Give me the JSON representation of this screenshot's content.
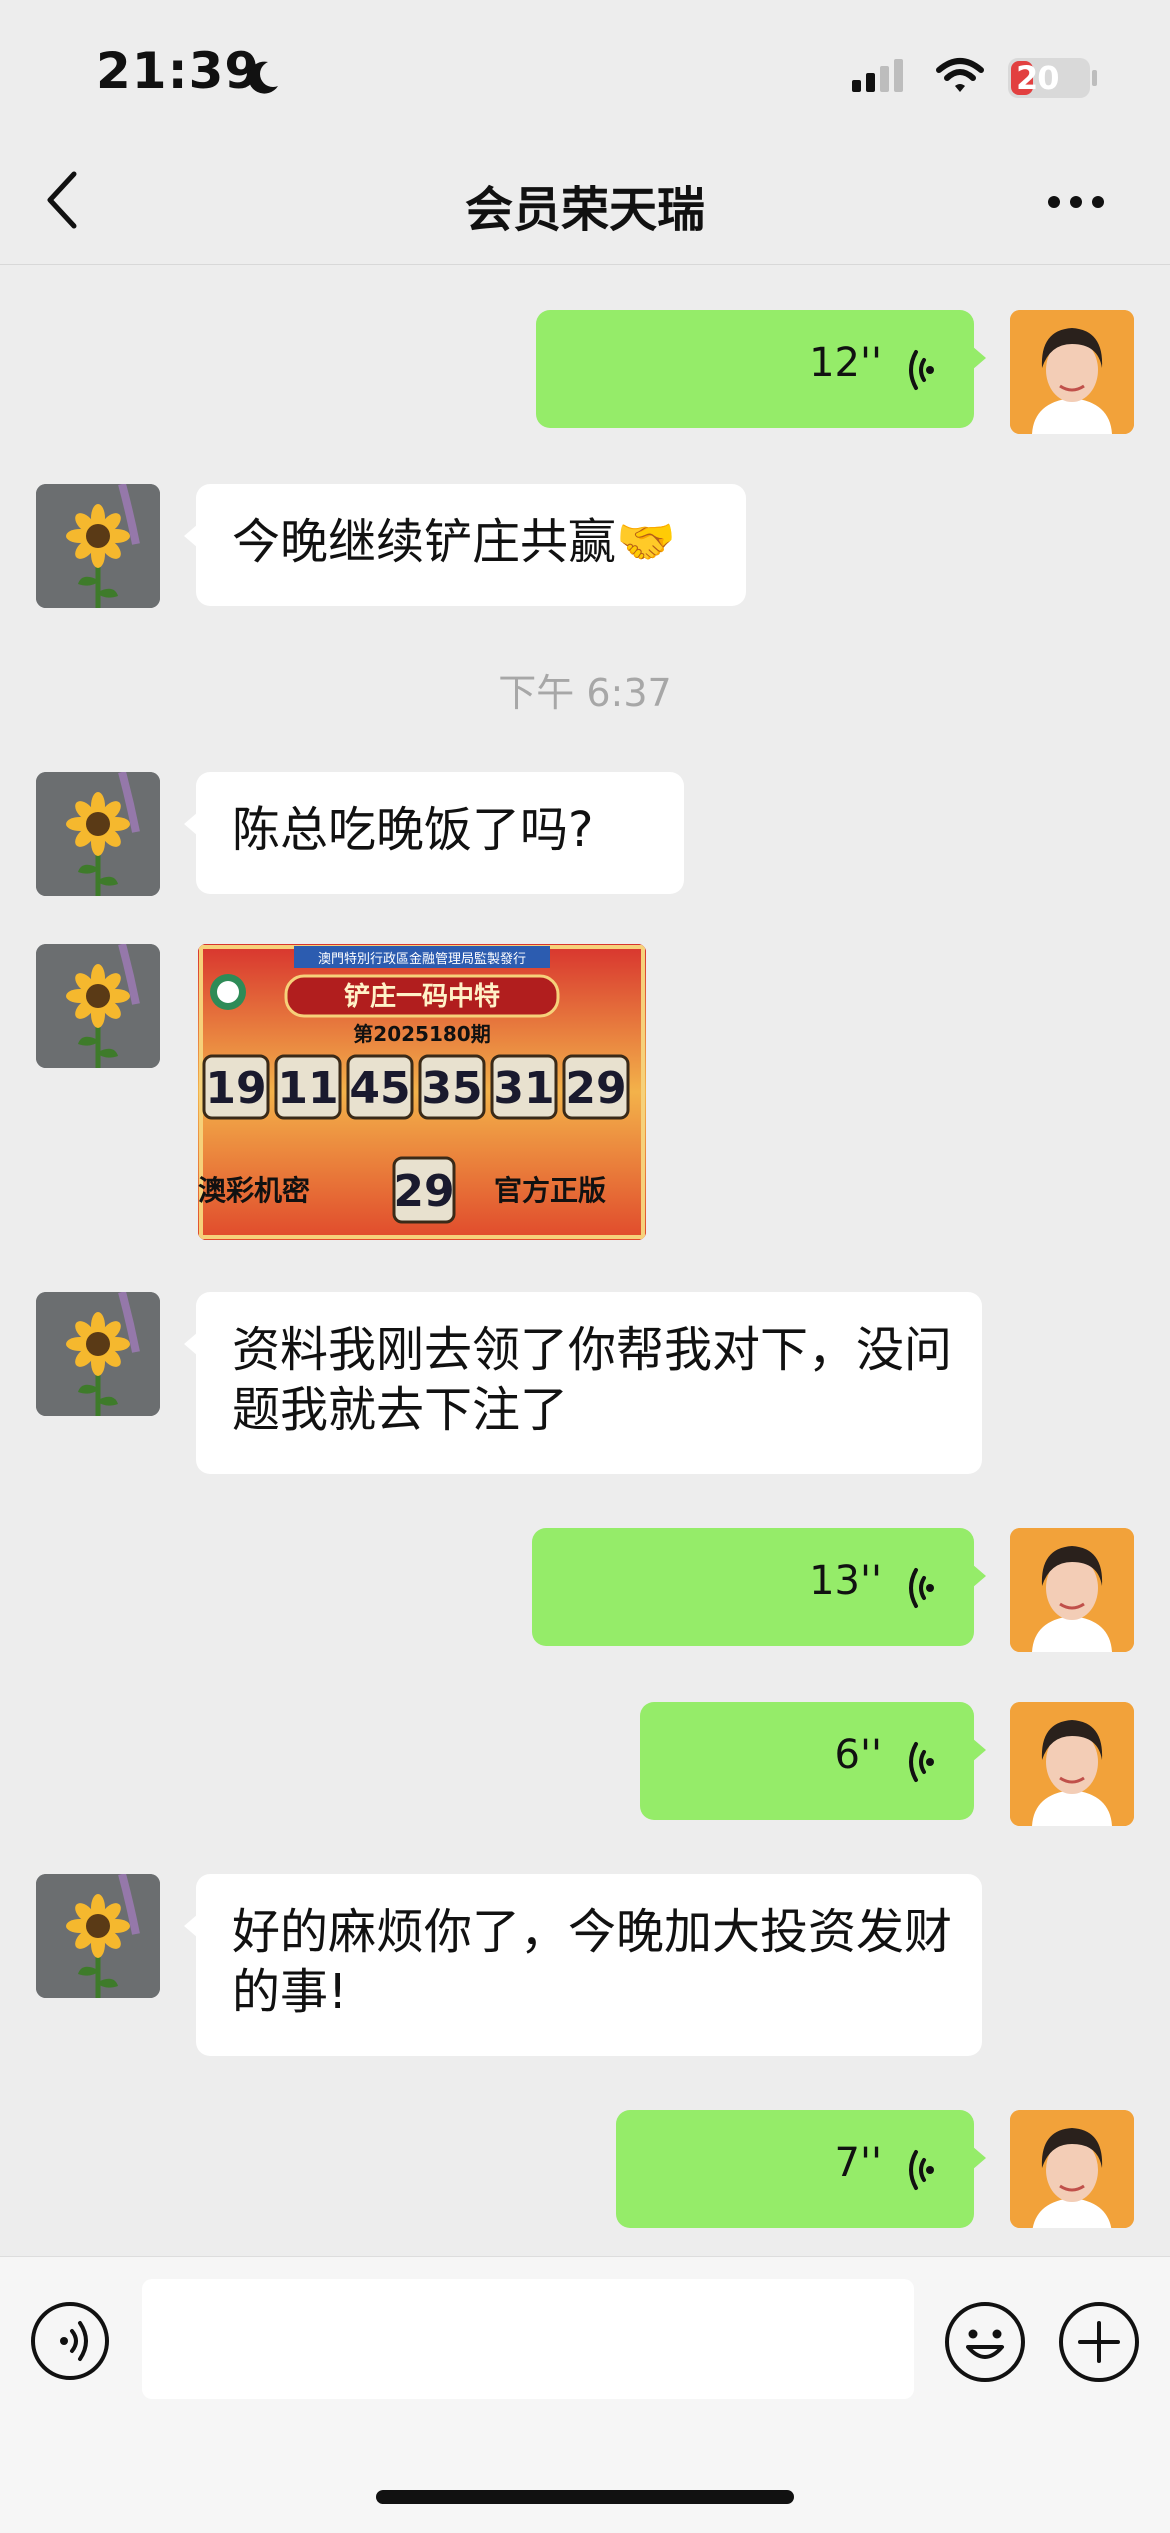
{
  "status_bar": {
    "time": "21:39",
    "battery_level": "20"
  },
  "header": {
    "title": "会员荣天瑞"
  },
  "messages": [
    {
      "from": "self",
      "type": "voice",
      "duration": "12''"
    },
    {
      "from": "other",
      "type": "text",
      "text": "今晚继续铲庄共赢🤝"
    },
    {
      "type": "timestamp",
      "text": "下午 6:37"
    },
    {
      "from": "other",
      "type": "text",
      "text": "陈总吃晚饭了吗?"
    },
    {
      "from": "other",
      "type": "image",
      "image": {
        "header": "澳門特別行政區金融管理局監製發行",
        "title": "铲庄一码中特",
        "issue": "第2025180期",
        "numbers": [
          "19",
          "11",
          "45",
          "35",
          "31",
          "29"
        ],
        "special": "29",
        "left_label": "澳彩机密",
        "right_label": "官方正版"
      }
    },
    {
      "from": "other",
      "type": "text",
      "text": "资料我刚去领了你帮我对下，没问题我就去下注了"
    },
    {
      "from": "self",
      "type": "voice",
      "duration": "13''"
    },
    {
      "from": "self",
      "type": "voice",
      "duration": "6''"
    },
    {
      "from": "other",
      "type": "text",
      "text": "好的麻烦你了，今晚加大投资发财的事!"
    },
    {
      "from": "self",
      "type": "voice",
      "duration": "7''"
    }
  ],
  "input": {
    "value": ""
  },
  "icons": {
    "back": "chevron-left-icon",
    "more": "more-dots-icon",
    "voice_wave": "voice-wave-icon",
    "voice_toggle": "voice-toggle-icon",
    "emoji": "emoji-icon",
    "plus": "plus-icon"
  },
  "colors": {
    "outgoing_bubble": "#95EC69",
    "incoming_bubble": "#FFFFFF",
    "background": "#EDEDED"
  }
}
